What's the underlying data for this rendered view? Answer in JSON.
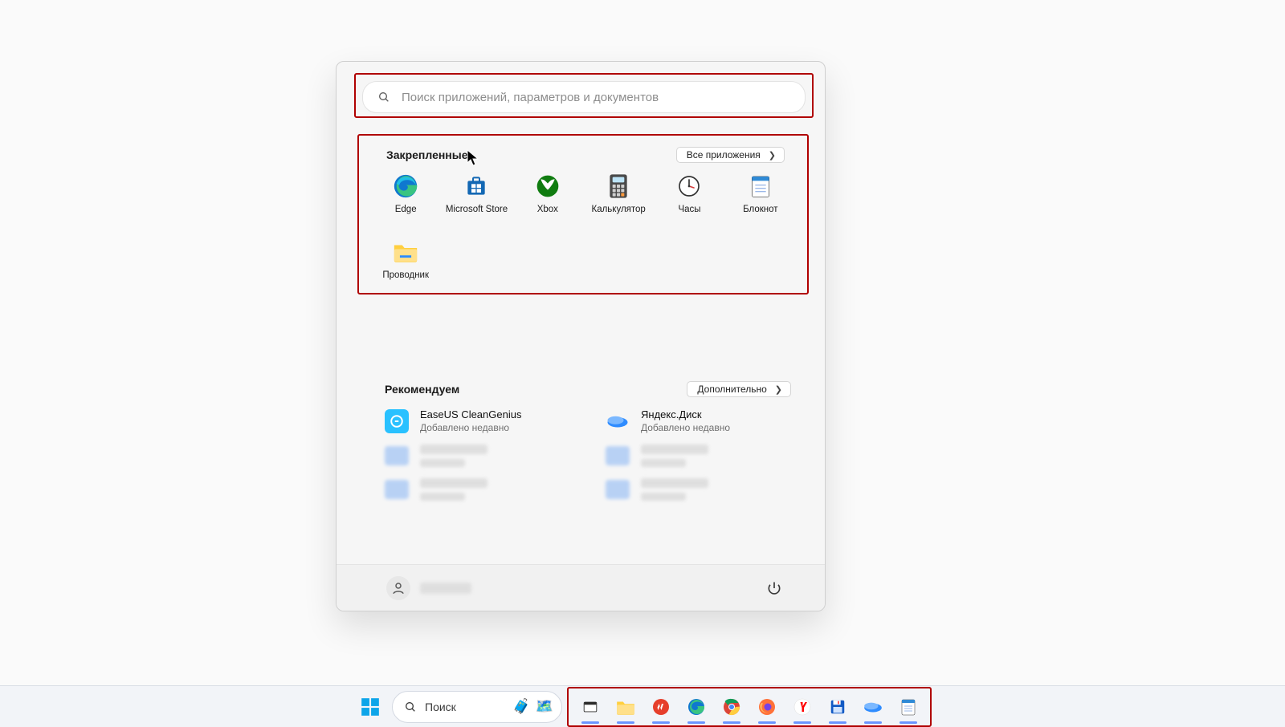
{
  "search": {
    "placeholder": "Поиск приложений, параметров и документов"
  },
  "pinned": {
    "title": "Закрепленные",
    "all_button": "Все приложения",
    "apps": [
      {
        "id": "edge",
        "label": "Edge"
      },
      {
        "id": "store",
        "label": "Microsoft Store"
      },
      {
        "id": "xbox",
        "label": "Xbox"
      },
      {
        "id": "calc",
        "label": "Калькулятор"
      },
      {
        "id": "clock",
        "label": "Часы"
      },
      {
        "id": "notepad",
        "label": "Блокнот"
      },
      {
        "id": "explorer",
        "label": "Проводник"
      }
    ]
  },
  "recommended": {
    "title": "Рекомендуем",
    "more_button": "Дополнительно",
    "items": [
      {
        "id": "easeus",
        "name": "EaseUS CleanGenius",
        "sub": "Добавлено недавно"
      },
      {
        "id": "yadisk",
        "name": "Яндекс.Диск",
        "sub": "Добавлено недавно"
      }
    ]
  },
  "taskbar": {
    "search_label": "Поиск",
    "apps": [
      {
        "id": "taskview",
        "name": "task-view-icon"
      },
      {
        "id": "explorer",
        "name": "file-explorer-icon"
      },
      {
        "id": "wps",
        "name": "wps-office-icon"
      },
      {
        "id": "edge",
        "name": "edge-icon"
      },
      {
        "id": "chrome",
        "name": "chrome-icon"
      },
      {
        "id": "firefox",
        "name": "firefox-icon"
      },
      {
        "id": "yandex",
        "name": "yandex-browser-icon"
      },
      {
        "id": "save",
        "name": "floppy-disk-icon"
      },
      {
        "id": "cloud",
        "name": "cloud-app-icon"
      },
      {
        "id": "notepad",
        "name": "notepad-icon"
      }
    ]
  },
  "colors": {
    "highlight_border": "#b00000",
    "accent": "#0078d4"
  }
}
